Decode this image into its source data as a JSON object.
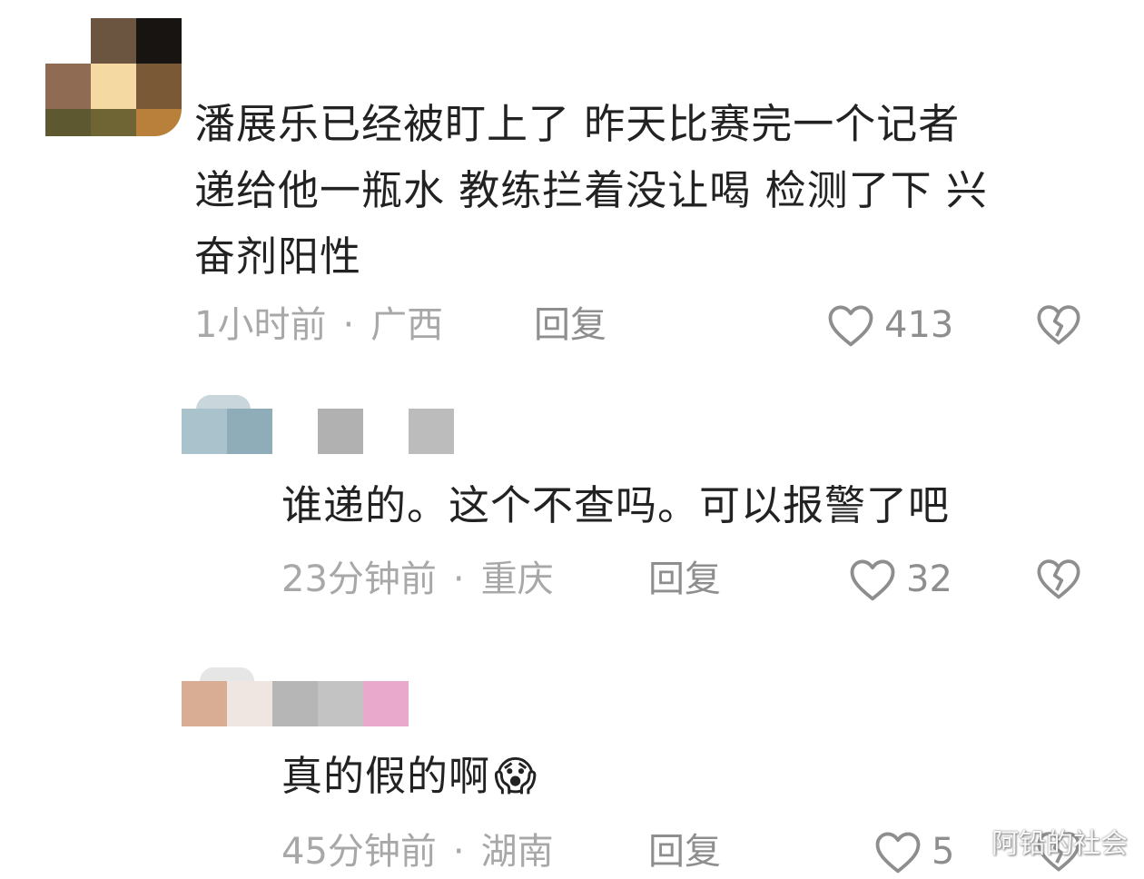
{
  "comments": [
    {
      "text_lines": [
        "潘展乐已经被盯上了 昨天比赛完一个记者",
        "递给他一瓶水 教练拦着没让喝 检测了下 兴",
        "奋剂阳性"
      ],
      "time": "1小时前",
      "separator": "·",
      "location": "广西",
      "reply_label": "回复",
      "likes": "413"
    },
    {
      "text_lines": [
        "谁递的。这个不查吗。可以报警了吧"
      ],
      "time": "23分钟前",
      "separator": "·",
      "location": "重庆",
      "reply_label": "回复",
      "likes": "32"
    },
    {
      "text_lines": [
        "真的假的啊"
      ],
      "emoji": "😱",
      "time": "45分钟前",
      "separator": "·",
      "location": "湖南",
      "reply_label": "回复",
      "likes": "5"
    }
  ],
  "watermark": "阿铅的社会",
  "icons": {
    "like": "heart-outline-icon",
    "dislike": "broken-heart-icon"
  },
  "colors": {
    "text": "#222222",
    "meta": "#a8a8a8",
    "action": "#8e8e8e"
  }
}
